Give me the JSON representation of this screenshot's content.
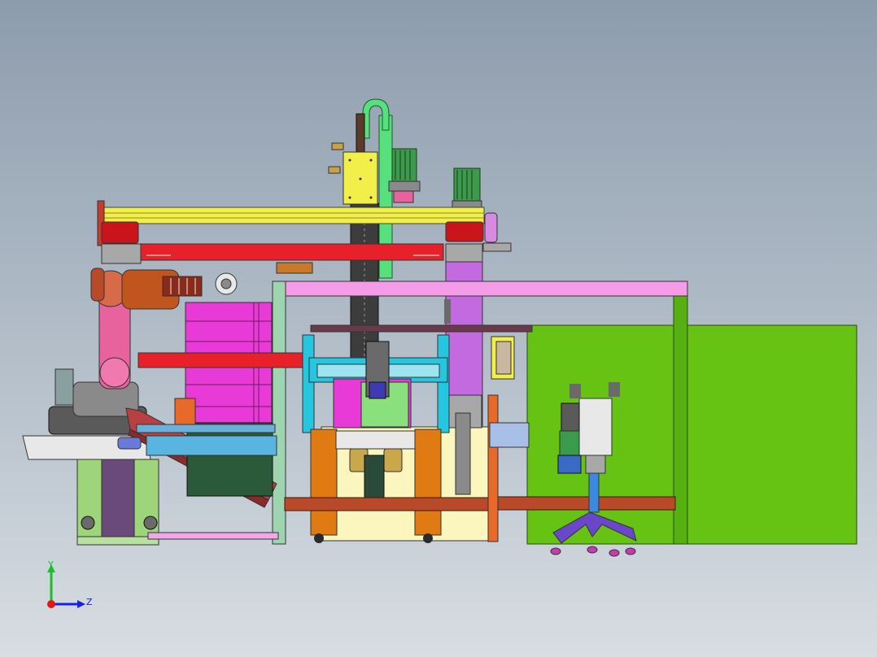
{
  "triad": {
    "y_label": "Y",
    "z_label": "Z",
    "y_color": "#16c02a",
    "z_color": "#1622e6",
    "origin_color": "#e01818"
  },
  "colors": {
    "background_top": "#8d9cad",
    "background_bottom": "#d8dde2",
    "gantry_beam_yellow": "#f2ee4a",
    "gantry_red": "#e8202a",
    "robot_body": "#e8629e",
    "robot_arm_orange": "#c0551e",
    "magenta_cage": "#e83ad6",
    "frame_pink": "#f59ce8",
    "column_violet": "#c46ae0",
    "cyan_frame": "#25c6e0",
    "orange_legs": "#e07a12",
    "cream_base": "#fbf6bd",
    "green_panel": "#66c313",
    "light_green": "#9ed47a",
    "motor_green": "#3c9a4c",
    "conveyor_red": "#b84040",
    "purple_base": "#6a46c8"
  }
}
